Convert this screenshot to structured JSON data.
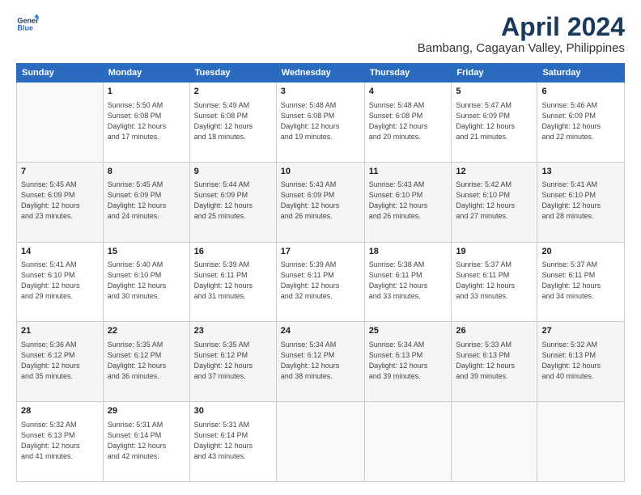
{
  "header": {
    "logo_line1": "General",
    "logo_line2": "Blue",
    "title": "April 2024",
    "subtitle": "Bambang, Cagayan Valley, Philippines"
  },
  "weekdays": [
    "Sunday",
    "Monday",
    "Tuesday",
    "Wednesday",
    "Thursday",
    "Friday",
    "Saturday"
  ],
  "weeks": [
    [
      {
        "day": "",
        "info": ""
      },
      {
        "day": "1",
        "info": "Sunrise: 5:50 AM\nSunset: 6:08 PM\nDaylight: 12 hours\nand 17 minutes."
      },
      {
        "day": "2",
        "info": "Sunrise: 5:49 AM\nSunset: 6:08 PM\nDaylight: 12 hours\nand 18 minutes."
      },
      {
        "day": "3",
        "info": "Sunrise: 5:48 AM\nSunset: 6:08 PM\nDaylight: 12 hours\nand 19 minutes."
      },
      {
        "day": "4",
        "info": "Sunrise: 5:48 AM\nSunset: 6:08 PM\nDaylight: 12 hours\nand 20 minutes."
      },
      {
        "day": "5",
        "info": "Sunrise: 5:47 AM\nSunset: 6:09 PM\nDaylight: 12 hours\nand 21 minutes."
      },
      {
        "day": "6",
        "info": "Sunrise: 5:46 AM\nSunset: 6:09 PM\nDaylight: 12 hours\nand 22 minutes."
      }
    ],
    [
      {
        "day": "7",
        "info": "Sunrise: 5:45 AM\nSunset: 6:09 PM\nDaylight: 12 hours\nand 23 minutes."
      },
      {
        "day": "8",
        "info": "Sunrise: 5:45 AM\nSunset: 6:09 PM\nDaylight: 12 hours\nand 24 minutes."
      },
      {
        "day": "9",
        "info": "Sunrise: 5:44 AM\nSunset: 6:09 PM\nDaylight: 12 hours\nand 25 minutes."
      },
      {
        "day": "10",
        "info": "Sunrise: 5:43 AM\nSunset: 6:09 PM\nDaylight: 12 hours\nand 26 minutes."
      },
      {
        "day": "11",
        "info": "Sunrise: 5:43 AM\nSunset: 6:10 PM\nDaylight: 12 hours\nand 26 minutes."
      },
      {
        "day": "12",
        "info": "Sunrise: 5:42 AM\nSunset: 6:10 PM\nDaylight: 12 hours\nand 27 minutes."
      },
      {
        "day": "13",
        "info": "Sunrise: 5:41 AM\nSunset: 6:10 PM\nDaylight: 12 hours\nand 28 minutes."
      }
    ],
    [
      {
        "day": "14",
        "info": "Sunrise: 5:41 AM\nSunset: 6:10 PM\nDaylight: 12 hours\nand 29 minutes."
      },
      {
        "day": "15",
        "info": "Sunrise: 5:40 AM\nSunset: 6:10 PM\nDaylight: 12 hours\nand 30 minutes."
      },
      {
        "day": "16",
        "info": "Sunrise: 5:39 AM\nSunset: 6:11 PM\nDaylight: 12 hours\nand 31 minutes."
      },
      {
        "day": "17",
        "info": "Sunrise: 5:39 AM\nSunset: 6:11 PM\nDaylight: 12 hours\nand 32 minutes."
      },
      {
        "day": "18",
        "info": "Sunrise: 5:38 AM\nSunset: 6:11 PM\nDaylight: 12 hours\nand 33 minutes."
      },
      {
        "day": "19",
        "info": "Sunrise: 5:37 AM\nSunset: 6:11 PM\nDaylight: 12 hours\nand 33 minutes."
      },
      {
        "day": "20",
        "info": "Sunrise: 5:37 AM\nSunset: 6:11 PM\nDaylight: 12 hours\nand 34 minutes."
      }
    ],
    [
      {
        "day": "21",
        "info": "Sunrise: 5:36 AM\nSunset: 6:12 PM\nDaylight: 12 hours\nand 35 minutes."
      },
      {
        "day": "22",
        "info": "Sunrise: 5:35 AM\nSunset: 6:12 PM\nDaylight: 12 hours\nand 36 minutes."
      },
      {
        "day": "23",
        "info": "Sunrise: 5:35 AM\nSunset: 6:12 PM\nDaylight: 12 hours\nand 37 minutes."
      },
      {
        "day": "24",
        "info": "Sunrise: 5:34 AM\nSunset: 6:12 PM\nDaylight: 12 hours\nand 38 minutes."
      },
      {
        "day": "25",
        "info": "Sunrise: 5:34 AM\nSunset: 6:13 PM\nDaylight: 12 hours\nand 39 minutes."
      },
      {
        "day": "26",
        "info": "Sunrise: 5:33 AM\nSunset: 6:13 PM\nDaylight: 12 hours\nand 39 minutes."
      },
      {
        "day": "27",
        "info": "Sunrise: 5:32 AM\nSunset: 6:13 PM\nDaylight: 12 hours\nand 40 minutes."
      }
    ],
    [
      {
        "day": "28",
        "info": "Sunrise: 5:32 AM\nSunset: 6:13 PM\nDaylight: 12 hours\nand 41 minutes."
      },
      {
        "day": "29",
        "info": "Sunrise: 5:31 AM\nSunset: 6:14 PM\nDaylight: 12 hours\nand 42 minutes."
      },
      {
        "day": "30",
        "info": "Sunrise: 5:31 AM\nSunset: 6:14 PM\nDaylight: 12 hours\nand 43 minutes."
      },
      {
        "day": "",
        "info": ""
      },
      {
        "day": "",
        "info": ""
      },
      {
        "day": "",
        "info": ""
      },
      {
        "day": "",
        "info": ""
      }
    ]
  ],
  "colors": {
    "header_bg": "#2a6bbf",
    "accent": "#1a3a5c"
  }
}
